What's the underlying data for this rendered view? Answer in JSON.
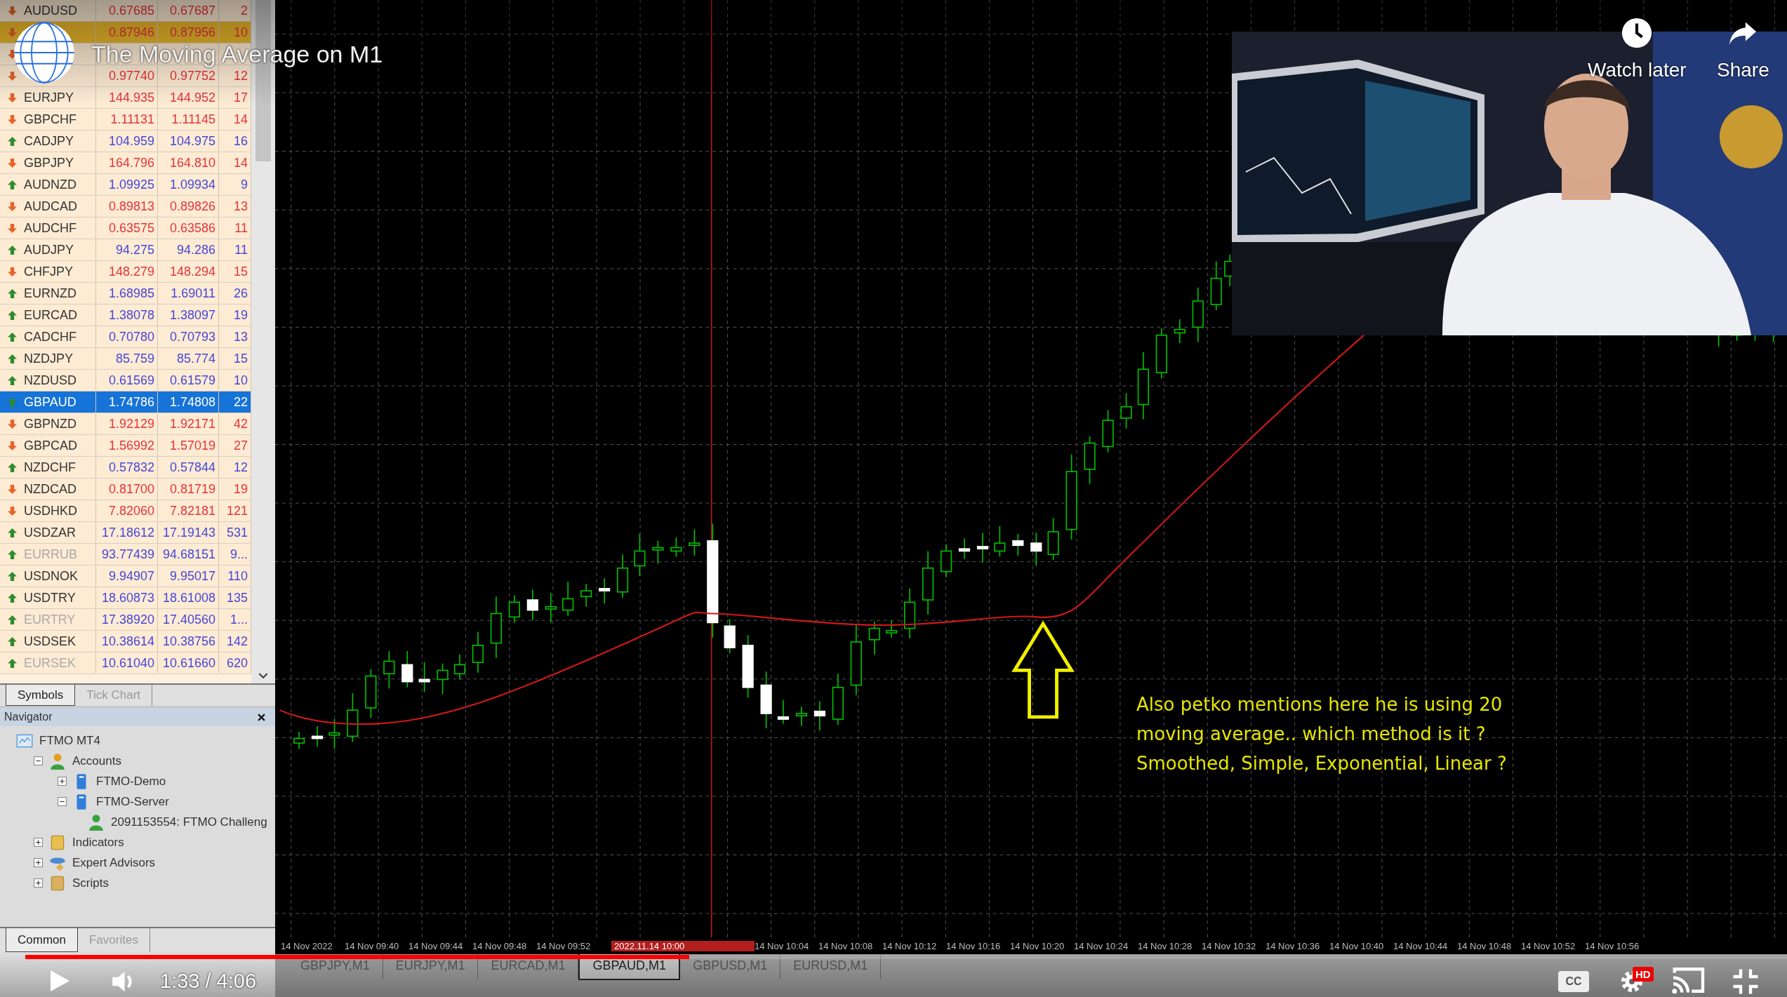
{
  "video": {
    "title": "The Moving Average on M1",
    "actions": [
      {
        "kind": "watch_later",
        "label": "Watch later"
      },
      {
        "kind": "share",
        "label": "Share"
      }
    ],
    "time": "1:33 / 4:06",
    "progress": {
      "level": 0.377
    },
    "captions": "CC",
    "quality_badge": "HD"
  },
  "market_watch": {
    "rows": [
      {
        "symbol": "AUDUSD",
        "bid": "0.67685",
        "ask": "0.67687",
        "spread": "2",
        "rising": false,
        "selected": false,
        "highlighted": false,
        "dimmed": false
      },
      {
        "bid": "0.87946",
        "ask": "0.87956",
        "spread": "10",
        "rising": false,
        "selected": false,
        "highlighted": true
      },
      {
        "rising": false,
        "selected": false,
        "highlighted": false
      },
      {
        "bid": "0.97740",
        "ask": "0.97752",
        "spread": "12",
        "rising": false,
        "selected": false,
        "highlighted": false
      },
      {
        "symbol": "EURJPY",
        "bid": "144.935",
        "ask": "144.952",
        "spread": "17",
        "rising": false,
        "selected": false,
        "highlighted": false,
        "dimmed": false
      },
      {
        "symbol": "GBPCHF",
        "bid": "1.11131",
        "ask": "1.11145",
        "spread": "14",
        "rising": false,
        "selected": false,
        "highlighted": false,
        "dimmed": false
      },
      {
        "symbol": "CADJPY",
        "bid": "104.959",
        "ask": "104.975",
        "spread": "16",
        "rising": true,
        "selected": false,
        "highlighted": false,
        "dimmed": false
      },
      {
        "symbol": "GBPJPY",
        "bid": "164.796",
        "ask": "164.810",
        "spread": "14",
        "rising": false,
        "selected": false,
        "highlighted": false,
        "dimmed": false
      },
      {
        "symbol": "AUDNZD",
        "bid": "1.09925",
        "ask": "1.09934",
        "spread": "9",
        "rising": true,
        "selected": false,
        "highlighted": false,
        "dimmed": false
      },
      {
        "symbol": "AUDCAD",
        "bid": "0.89813",
        "ask": "0.89826",
        "spread": "13",
        "rising": false,
        "selected": false,
        "highlighted": false,
        "dimmed": false
      },
      {
        "symbol": "AUDCHF",
        "bid": "0.63575",
        "ask": "0.63586",
        "spread": "11",
        "rising": false,
        "selected": false,
        "highlighted": false,
        "dimmed": false
      },
      {
        "symbol": "AUDJPY",
        "bid": "94.275",
        "ask": "94.286",
        "spread": "11",
        "rising": true,
        "selected": false,
        "highlighted": false,
        "dimmed": false
      },
      {
        "symbol": "CHFJPY",
        "bid": "148.279",
        "ask": "148.294",
        "spread": "15",
        "rising": false,
        "selected": false,
        "highlighted": false,
        "dimmed": false
      },
      {
        "symbol": "EURNZD",
        "bid": "1.68985",
        "ask": "1.69011",
        "spread": "26",
        "rising": true,
        "selected": false,
        "highlighted": false,
        "dimmed": false
      },
      {
        "symbol": "EURCAD",
        "bid": "1.38078",
        "ask": "1.38097",
        "spread": "19",
        "rising": true,
        "selected": false,
        "highlighted": false,
        "dimmed": false
      },
      {
        "symbol": "CADCHF",
        "bid": "0.70780",
        "ask": "0.70793",
        "spread": "13",
        "rising": true,
        "selected": false,
        "highlighted": false,
        "dimmed": false
      },
      {
        "symbol": "NZDJPY",
        "bid": "85.759",
        "ask": "85.774",
        "spread": "15",
        "rising": true,
        "selected": false,
        "highlighted": false,
        "dimmed": false
      },
      {
        "symbol": "NZDUSD",
        "bid": "0.61569",
        "ask": "0.61579",
        "spread": "10",
        "rising": true,
        "selected": false,
        "highlighted": false,
        "dimmed": false
      },
      {
        "symbol": "GBPAUD",
        "bid": "1.74786",
        "ask": "1.74808",
        "spread": "22",
        "rising": true,
        "selected": true,
        "highlighted": false,
        "dimmed": false
      },
      {
        "symbol": "GBPNZD",
        "bid": "1.92129",
        "ask": "1.92171",
        "spread": "42",
        "rising": false,
        "selected": false,
        "highlighted": false,
        "dimmed": false
      },
      {
        "symbol": "GBPCAD",
        "bid": "1.56992",
        "ask": "1.57019",
        "spread": "27",
        "rising": false,
        "selected": false,
        "highlighted": false,
        "dimmed": false
      },
      {
        "symbol": "NZDCHF",
        "bid": "0.57832",
        "ask": "0.57844",
        "spread": "12",
        "rising": true,
        "selected": false,
        "highlighted": false,
        "dimmed": false
      },
      {
        "symbol": "NZDCAD",
        "bid": "0.81700",
        "ask": "0.81719",
        "spread": "19",
        "rising": false,
        "selected": false,
        "highlighted": false,
        "dimmed": false
      },
      {
        "symbol": "USDHKD",
        "bid": "7.82060",
        "ask": "7.82181",
        "spread": "121",
        "rising": false,
        "selected": false,
        "highlighted": false,
        "dimmed": false
      },
      {
        "symbol": "USDZAR",
        "bid": "17.18612",
        "ask": "17.19143",
        "spread": "531",
        "rising": true,
        "selected": false,
        "highlighted": false,
        "dimmed": false
      },
      {
        "symbol": "EURRUB",
        "bid": "93.77439",
        "ask": "94.68151",
        "spread": "9...",
        "rising": true,
        "selected": false,
        "highlighted": false,
        "dimmed": true
      },
      {
        "symbol": "USDNOK",
        "bid": "9.94907",
        "ask": "9.95017",
        "spread": "110",
        "rising": true,
        "selected": false,
        "highlighted": false,
        "dimmed": false
      },
      {
        "symbol": "USDTRY",
        "bid": "18.60873",
        "ask": "18.61008",
        "spread": "135",
        "rising": true,
        "selected": false,
        "highlighted": false,
        "dimmed": false
      },
      {
        "symbol": "EURTRY",
        "bid": "17.38920",
        "ask": "17.40560",
        "spread": "1...",
        "rising": true,
        "selected": false,
        "highlighted": false,
        "dimmed": true
      },
      {
        "symbol": "USDSEK",
        "bid": "10.38614",
        "ask": "10.38756",
        "spread": "142",
        "rising": true,
        "selected": false,
        "highlighted": false,
        "dimmed": false
      },
      {
        "symbol": "EURSEK",
        "bid": "10.61040",
        "ask": "10.61660",
        "spread": "620",
        "rising": true,
        "selected": false,
        "highlighted": false,
        "dimmed": true
      }
    ],
    "tabs": [
      {
        "label": "Symbols",
        "selected": true
      },
      {
        "label": "Tick Chart",
        "selected": false
      }
    ]
  },
  "navigator": {
    "title": "Navigator",
    "tree": [
      {
        "label": "FTMO MT4",
        "kind": "terminal",
        "children": [
          {
            "label": "Accounts",
            "kind": "accounts",
            "expanded": true,
            "children": [
              {
                "label": "FTMO-Demo",
                "kind": "server",
                "expanded": false
              },
              {
                "label": "FTMO-Server",
                "kind": "server",
                "expanded": true,
                "children": [
                  {
                    "label": "2091153554: FTMO Challeng",
                    "kind": "account"
                  }
                ]
              }
            ]
          },
          {
            "label": "Indicators",
            "kind": "indicators",
            "expanded": false
          },
          {
            "label": "Expert Advisors",
            "kind": "experts",
            "expanded": false
          },
          {
            "label": "Scripts",
            "kind": "scripts",
            "expanded": false
          }
        ]
      }
    ],
    "tabs": [
      {
        "label": "Common",
        "selected": true
      },
      {
        "label": "Favorites",
        "selected": false
      }
    ]
  },
  "chart": {
    "time_labels": [
      {
        "kind": "time",
        "text": "14 Nov 2022"
      },
      {
        "kind": "time",
        "text": "14 Nov 09:40"
      },
      {
        "kind": "time",
        "text": "14 Nov 09:44"
      },
      {
        "kind": "time",
        "text": "14 Nov 09:48"
      },
      {
        "kind": "time",
        "text": "14 Nov 09:52"
      },
      {
        "kind": "cursor",
        "text": "2022.11.14 10:00"
      },
      {
        "kind": "time",
        "text": "14 Nov 10:04"
      },
      {
        "kind": "time",
        "text": "14 Nov 10:08"
      },
      {
        "kind": "time",
        "text": "14 Nov 10:12"
      },
      {
        "kind": "time",
        "text": "14 Nov 10:16"
      },
      {
        "kind": "time",
        "text": "14 Nov 10:20"
      },
      {
        "kind": "time",
        "text": "14 Nov 10:24"
      },
      {
        "kind": "time",
        "text": "14 Nov 10:28"
      },
      {
        "kind": "time",
        "text": "14 Nov 10:32"
      },
      {
        "kind": "time",
        "text": "14 Nov 10:36"
      },
      {
        "kind": "time",
        "text": "14 Nov 10:40"
      },
      {
        "kind": "time",
        "text": "14 Nov 10:44"
      },
      {
        "kind": "time",
        "text": "14 Nov 10:48"
      },
      {
        "kind": "time",
        "text": "14 Nov 10:52"
      },
      {
        "kind": "time",
        "text": "14 Nov 10:56"
      }
    ],
    "note": "Also petko mentions here he is using 20 moving average.. which method is it ? Smoothed, Simple, Exponential, Linear ?"
  },
  "chart_tabs": [
    {
      "label": "GBPJPY,M1",
      "selected": false
    },
    {
      "label": "EURJPY,M1",
      "selected": false
    },
    {
      "label": "EURCAD,M1",
      "selected": false
    },
    {
      "label": "GBPAUD,M1",
      "selected": true
    },
    {
      "label": "GBPUSD,M1",
      "selected": false
    },
    {
      "label": "EURUSD,M1",
      "selected": false
    }
  ]
}
